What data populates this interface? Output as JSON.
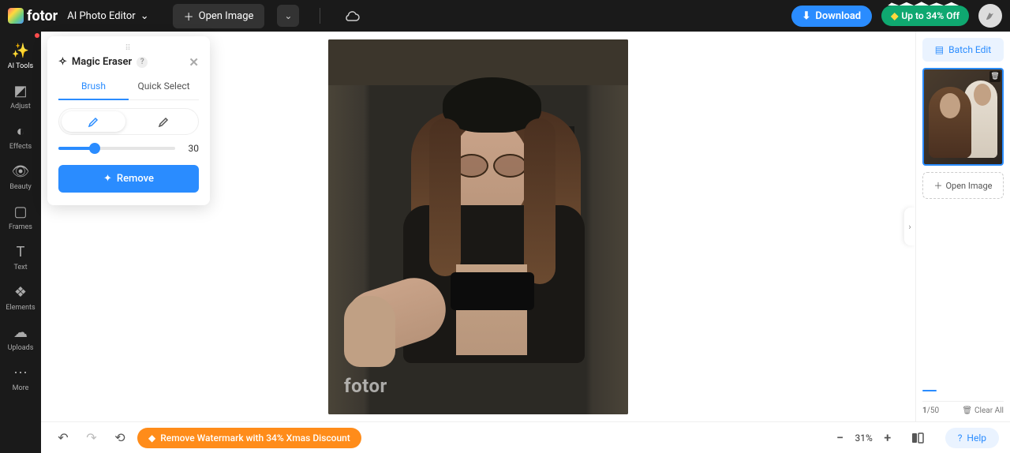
{
  "header": {
    "logo_text": "fotor",
    "title": "AI Photo Editor",
    "open_image": "Open Image",
    "download": "Download",
    "promo": "Up to 34% Off"
  },
  "sidebar": {
    "items": [
      {
        "label": "AI Tools",
        "icon": "✨"
      },
      {
        "label": "Adjust",
        "icon": "◩"
      },
      {
        "label": "Effects",
        "icon": "◐"
      },
      {
        "label": "Beauty",
        "icon": "👁"
      },
      {
        "label": "Frames",
        "icon": "▢"
      },
      {
        "label": "Text",
        "icon": "T"
      },
      {
        "label": "Elements",
        "icon": "❖"
      },
      {
        "label": "Uploads",
        "icon": "☁"
      },
      {
        "label": "More",
        "icon": "⋯"
      }
    ]
  },
  "panel": {
    "title": "Magic Eraser",
    "tabs": {
      "brush": "Brush",
      "quick": "Quick Select"
    },
    "brush_size": 30,
    "remove": "Remove"
  },
  "canvas": {
    "watermark": "fotor"
  },
  "right": {
    "batch": "Batch Edit",
    "open_image": "Open Image",
    "page_current": "1",
    "page_total": "/50",
    "clear_all": "Clear All"
  },
  "bottom": {
    "watermark_promo": "Remove Watermark with 34% Xmas Discount",
    "zoom": "31%",
    "help": "Help"
  }
}
